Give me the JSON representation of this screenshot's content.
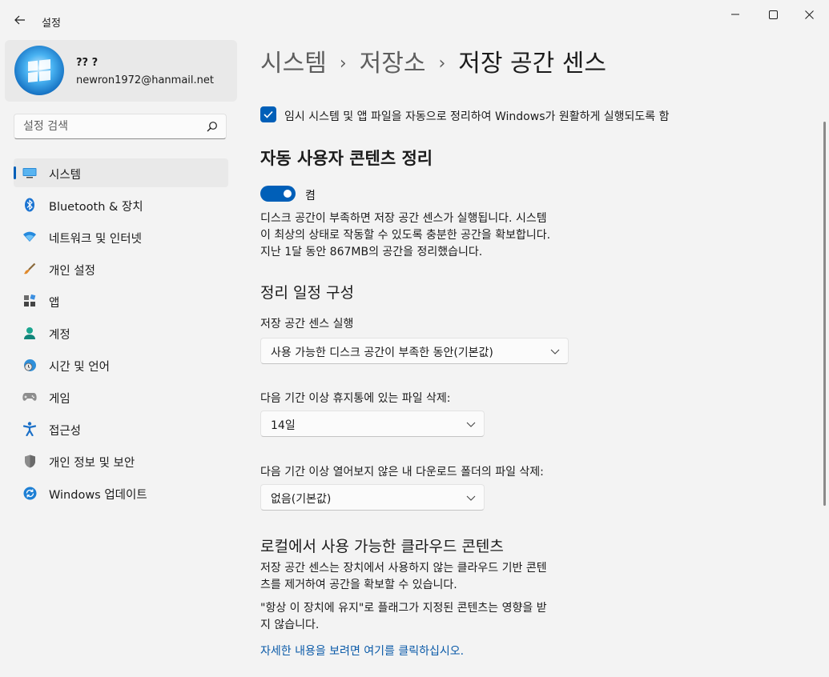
{
  "window": {
    "title": "설정"
  },
  "profile": {
    "name": "?? ?",
    "email": "newron1972@hanmail.net"
  },
  "search": {
    "placeholder": "설정 검색"
  },
  "sidebar": {
    "items": [
      {
        "label": "시스템",
        "icon": "system-icon",
        "active": true
      },
      {
        "label": "Bluetooth & 장치",
        "icon": "bluetooth-icon"
      },
      {
        "label": "네트워크 및 인터넷",
        "icon": "network-icon"
      },
      {
        "label": "개인 설정",
        "icon": "brush-icon"
      },
      {
        "label": "앱",
        "icon": "apps-icon"
      },
      {
        "label": "계정",
        "icon": "account-icon"
      },
      {
        "label": "시간 및 언어",
        "icon": "time-language-icon"
      },
      {
        "label": "게임",
        "icon": "gaming-icon"
      },
      {
        "label": "접근성",
        "icon": "accessibility-icon"
      },
      {
        "label": "개인 정보 및 보안",
        "icon": "shield-icon"
      },
      {
        "label": "Windows 업데이트",
        "icon": "update-icon"
      }
    ]
  },
  "breadcrumb": {
    "item1": "시스템",
    "item2": "저장소",
    "current": "저장 공간 센스",
    "separator": "›"
  },
  "main": {
    "temp_checkbox_label": "임시 시스템 및 앱 파일을 자동으로 정리하여 Windows가 원활하게 실행되도록 함",
    "temp_checkbox_checked": true,
    "auto_cleanup_heading": "자동 사용자 콘텐츠 정리",
    "toggle_state": "켬",
    "toggle_on": true,
    "description_lines": [
      "디스크 공간이 부족하면 저장 공간 센스가 실행됩니다. 시스템",
      "이 최상의 상태로 작동할 수 있도록 충분한 공간을 확보합니다.",
      "지난 1달 동안 867MB의 공간을 정리했습니다."
    ],
    "schedule_heading": "정리 일정 구성",
    "run_label": "저장 공간 센스 실행",
    "run_value": "사용 가능한 디스크 공간이 부족한 동안(기본값)",
    "recycle_label": "다음 기간 이상 휴지통에 있는 파일 삭제:",
    "recycle_value": "14일",
    "downloads_label": "다음 기간 이상 열어보지 않은 내 다운로드 폴더의 파일 삭제:",
    "downloads_value": "없음(기본값)",
    "cloud_heading": "로컬에서 사용 가능한 클라우드 콘텐츠",
    "cloud_desc_lines": [
      "저장 공간 센스는 장치에서 사용하지 않는 클라우드 기반 콘텐",
      "츠를 제거하여 공간을 확보할 수 있습니다."
    ],
    "cloud_note_lines": [
      "\"항상 이 장치에 유지\"로 플래그가 지정된 콘텐츠는 영향을 받",
      "지 않습니다."
    ],
    "learn_more_link": "자세한 내용을 보려면 여기를 클릭하십시오."
  },
  "colors": {
    "accent": "#005fb8",
    "background": "#f3f3f3",
    "link": "#0a5aa8"
  }
}
